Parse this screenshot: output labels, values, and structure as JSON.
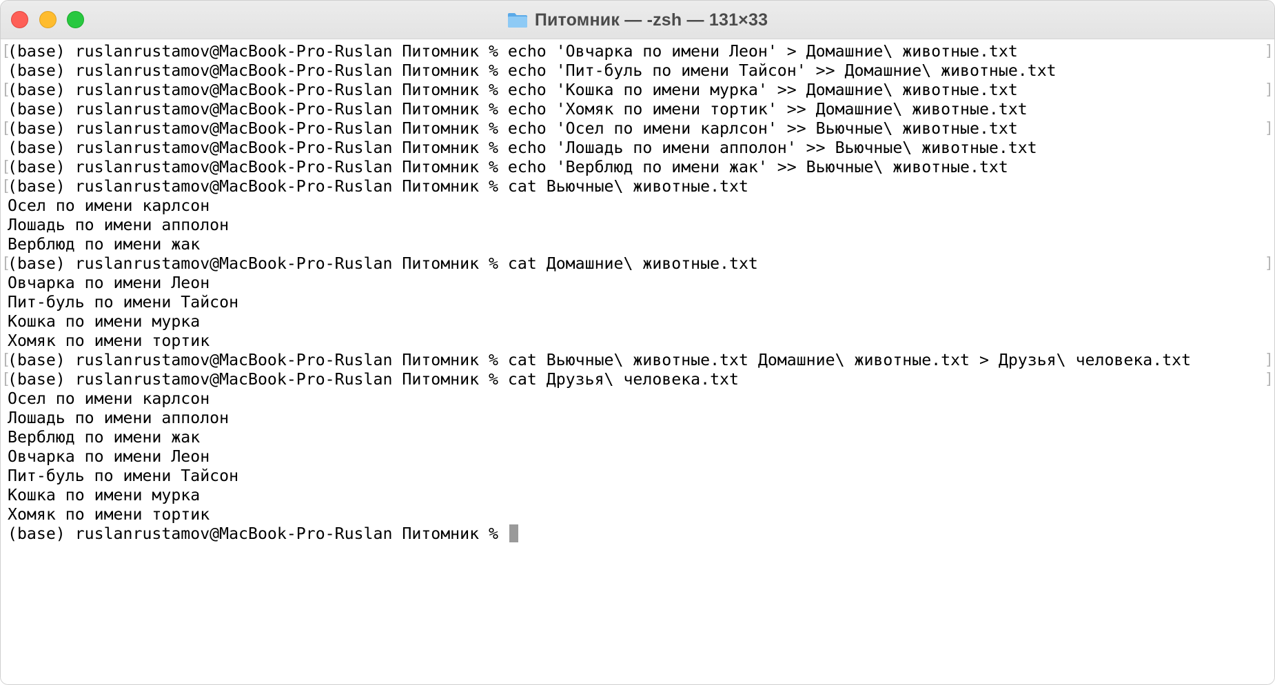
{
  "window": {
    "title": "Питомник — -zsh — 131×33",
    "folder_icon": "folder-icon"
  },
  "terminal": {
    "lines": [
      "(base) ruslanrustamov@MacBook-Pro-Ruslan Питомник % echo 'Овчарка по имени Леон' > Домашние\\ животные.txt",
      "(base) ruslanrustamov@MacBook-Pro-Ruslan Питомник % echo 'Пит-буль по имени Тайсон' >> Домашние\\ животные.txt",
      "(base) ruslanrustamov@MacBook-Pro-Ruslan Питомник % echo 'Кошка по имени мурка' >> Домашние\\ животные.txt",
      "(base) ruslanrustamov@MacBook-Pro-Ruslan Питомник % echo 'Хомяк по имени тортик' >> Домашние\\ животные.txt",
      "(base) ruslanrustamov@MacBook-Pro-Ruslan Питомник % echo 'Осел по имени карлсон' >> Вьючные\\ животные.txt",
      "(base) ruslanrustamov@MacBook-Pro-Ruslan Питомник % echo 'Лошадь по имени апполон' >> Вьючные\\ животные.txt",
      "(base) ruslanrustamov@MacBook-Pro-Ruslan Питомник % echo 'Верблюд по имени жак' >> Вьючные\\ животные.txt",
      "(base) ruslanrustamov@MacBook-Pro-Ruslan Питомник % cat Вьючные\\ животные.txt",
      "Осел по имени карлсон",
      "Лошадь по имени апполон",
      "Верблюд по имени жак",
      "(base) ruslanrustamov@MacBook-Pro-Ruslan Питомник % cat Домашние\\ животные.txt",
      "Овчарка по имени Леон",
      "Пит-буль по имени Тайсон",
      "Кошка по имени мурка",
      "Хомяк по имени тортик",
      "(base) ruslanrustamov@MacBook-Pro-Ruslan Питомник % cat Вьючные\\ животные.txt Домашние\\ животные.txt > Друзья\\ человека.txt",
      "(base) ruslanrustamov@MacBook-Pro-Ruslan Питомник % cat Друзья\\ человека.txt",
      "Осел по имени карлсон",
      "Лошадь по имени апполон",
      "Верблюд по имени жак",
      "Овчарка по имени Леон",
      "Пит-буль по имени Тайсон",
      "Кошка по имени мурка",
      "Хомяк по имени тортик",
      "(base) ruslanrustamov@MacBook-Pro-Ruslan Питомник % "
    ],
    "left_marker": "[",
    "right_marker": "]",
    "left_marker_rows": [
      0,
      2,
      4,
      6,
      7,
      11,
      16,
      17
    ],
    "right_marker_rows": [
      0,
      2,
      4,
      11,
      16,
      17
    ]
  }
}
